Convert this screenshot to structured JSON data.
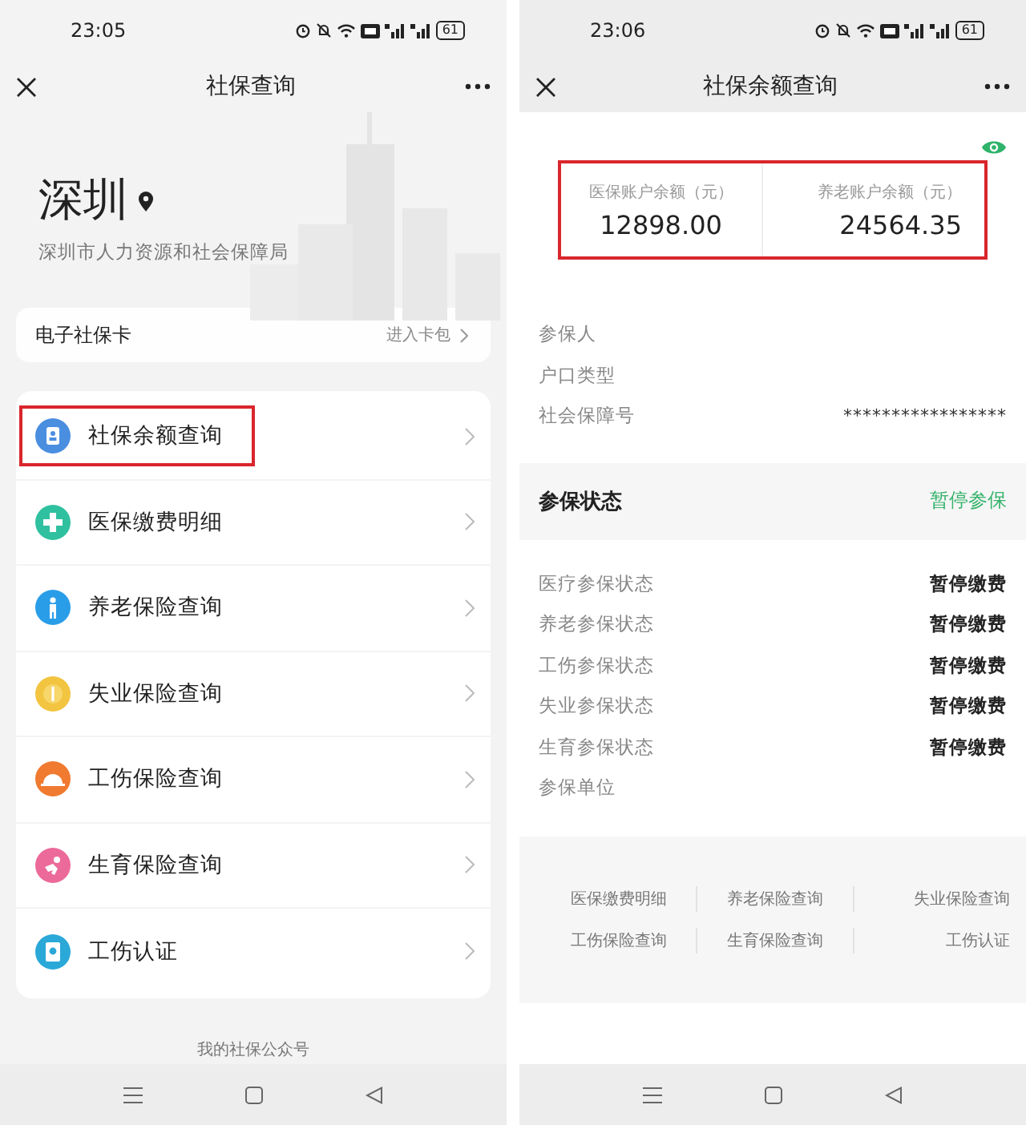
{
  "left_screen": {
    "status_bar": {
      "time": "23:05",
      "battery": "61"
    },
    "title": "社保查询",
    "city": "深圳",
    "agency": "深圳市人力资源和社会保障局",
    "card": {
      "label": "电子社保卡",
      "action": "进入卡包"
    },
    "menu": [
      {
        "label": "社保余额查询",
        "color": "#4a8ee0",
        "kind": "badge",
        "highlighted": true
      },
      {
        "label": "医保缴费明细",
        "color": "#2fc0a0",
        "kind": "plus",
        "highlighted": false
      },
      {
        "label": "养老保险查询",
        "color": "#2a9de8",
        "kind": "person",
        "highlighted": false
      },
      {
        "label": "失业保险查询",
        "color": "#f2c440",
        "kind": "coin",
        "highlighted": false
      },
      {
        "label": "工伤保险查询",
        "color": "#f07a30",
        "kind": "helmet",
        "highlighted": false
      },
      {
        "label": "生育保险查询",
        "color": "#ec6a9a",
        "kind": "baby",
        "highlighted": false
      },
      {
        "label": "工伤认证",
        "color": "#2aa8d8",
        "kind": "document",
        "highlighted": false
      }
    ],
    "footer": "我的社保公众号"
  },
  "right_screen": {
    "status_bar": {
      "time": "23:06",
      "battery": "61"
    },
    "title": "社保余额查询",
    "balances": {
      "highlighted": true,
      "items": [
        {
          "label": "医保账户余额（元）",
          "value": "12898.00"
        },
        {
          "label": "养老账户余额（元）",
          "value": "24564.35"
        }
      ]
    },
    "info_rows": [
      {
        "label": "参保人"
      },
      {
        "label": "户口类型"
      },
      {
        "label": "社会保障号",
        "value": "*****************"
      }
    ],
    "status_section": {
      "title": "参保状态",
      "status": "暂停参保"
    },
    "status_rows": [
      {
        "label": "医疗参保状态",
        "value": "暂停缴费"
      },
      {
        "label": "养老参保状态",
        "value": "暂停缴费"
      },
      {
        "label": "工伤参保状态",
        "value": "暂停缴费"
      },
      {
        "label": "失业参保状态",
        "value": "暂停缴费"
      },
      {
        "label": "生育参保状态",
        "value": "暂停缴费"
      },
      {
        "label": "参保单位"
      }
    ],
    "links": [
      "医保缴费明细",
      "养老保险查询",
      "失业保险查询",
      "工伤保险查询",
      "生育保险查询",
      "工伤认证"
    ]
  }
}
